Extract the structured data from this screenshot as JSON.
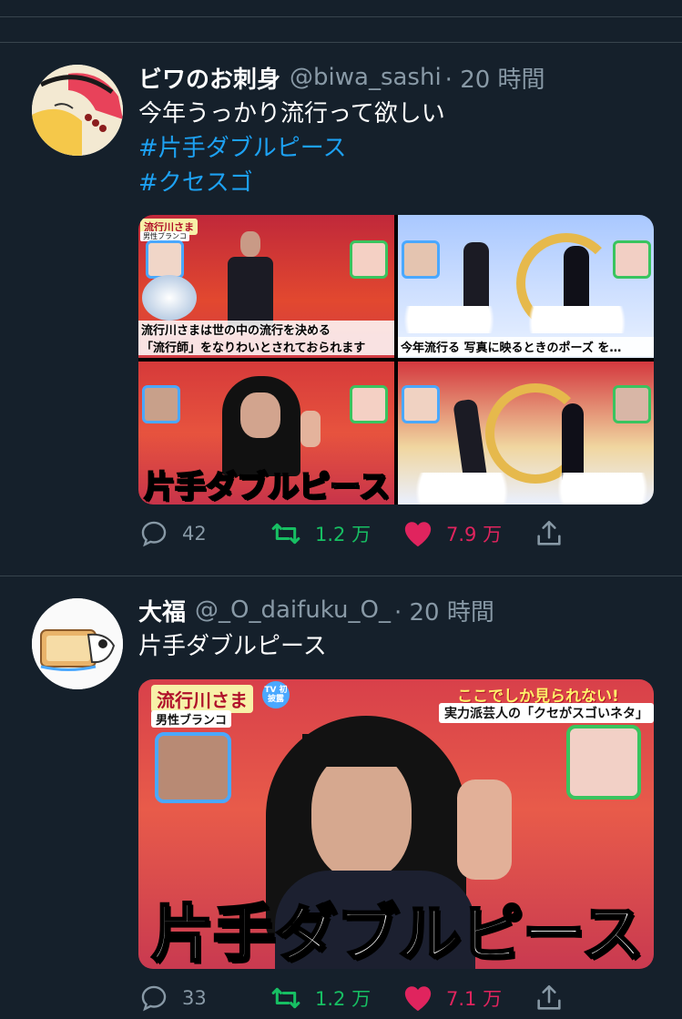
{
  "tweets": [
    {
      "display_name": "ビワのお刺身",
      "handle": "@biwa_sashi",
      "time": "· 20 時間",
      "text": "今年うっかり流行って欲しい",
      "hashtags": [
        "#片手ダブルピース",
        "#クセスゴ"
      ],
      "media": {
        "tl_caption_1": "流行川さまは世の中の流行を決める",
        "tl_caption_2": "「流行師」をなりわいとされておられます",
        "tr_caption": "今年流行る 写真に映るときのポーズ を…",
        "bl_caption": "片手ダブルピース",
        "show_label": "流行川さま",
        "show_sublabel": "男性ブランコ"
      },
      "actions": {
        "replies": "42",
        "retweets": "1.2 万",
        "likes": "7.9 万"
      }
    },
    {
      "display_name": "大福",
      "handle": "@_O_daifuku_O_",
      "time": "· 20 時間",
      "text": "片手ダブルピース",
      "media": {
        "show_label": "流行川さま",
        "show_sublabel": "男性ブランコ",
        "tv_badge": "TV 初披露",
        "banner_top": "ここでしか見られない!",
        "banner_bottom": "実力派芸人の「クセがスゴいネタ」",
        "caption": "片手ダブルピース"
      },
      "actions": {
        "replies": "33",
        "retweets": "1.2 万",
        "likes": "7.1 万"
      }
    }
  ],
  "colors": {
    "background": "#15202b",
    "separator": "#38444d",
    "text_primary": "#ffffff",
    "text_secondary": "#8899a6",
    "hashtag": "#1da1f2",
    "retweet": "#17bf63",
    "like": "#e0245e"
  },
  "icons": [
    "reply-icon",
    "retweet-icon",
    "like-icon",
    "share-icon"
  ]
}
